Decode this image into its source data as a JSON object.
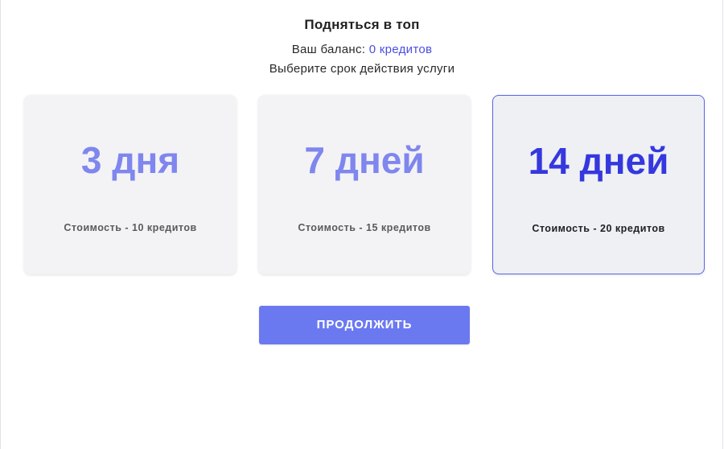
{
  "header": {
    "title": "Подняться в топ",
    "balance_label": "Ваш баланс: ",
    "balance_value": "0 кредитов",
    "subtitle": "Выберите срок действия услуги"
  },
  "options": [
    {
      "period": "3 дня",
      "price": "Стоимость - 10 кредитов",
      "selected": false
    },
    {
      "period": "7 дней",
      "price": "Стоимость - 15 кредитов",
      "selected": false
    },
    {
      "period": "14 дней",
      "price": "Стоимость - 20 кредитов",
      "selected": true
    }
  ],
  "actions": {
    "continue_label": "ПРОДОЛЖИТЬ"
  },
  "colors": {
    "accent": "#4a4fe0",
    "selected_border": "#5a64ec",
    "period_text": "#7f86ee",
    "period_text_selected": "#3538de",
    "button_bg": "#6b79f0",
    "card_bg": "#f3f3f5"
  }
}
